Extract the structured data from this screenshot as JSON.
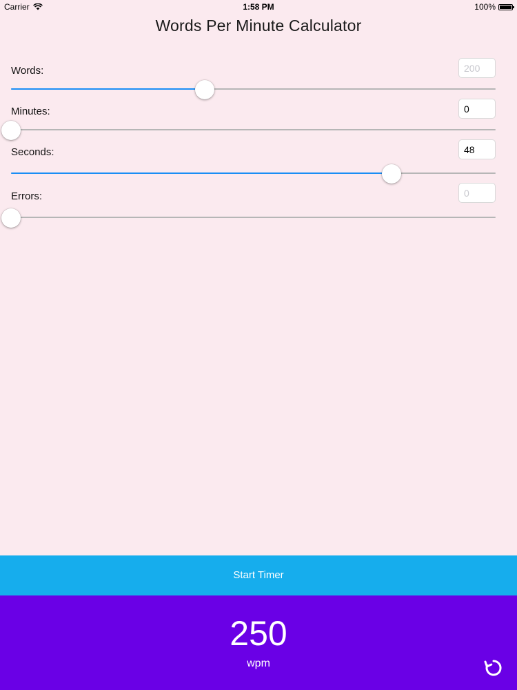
{
  "status_bar": {
    "carrier": "Carrier",
    "time": "1:58 PM",
    "battery": "100%",
    "icons": [
      "wifi-icon",
      "battery-icon"
    ]
  },
  "title": "Words Per Minute Calculator",
  "fields": [
    {
      "label": "Words:",
      "value": "",
      "placeholder": "200",
      "slider_fraction": 0.4
    },
    {
      "label": "Minutes:",
      "value": "0",
      "placeholder": "",
      "slider_fraction": 0.0
    },
    {
      "label": "Seconds:",
      "value": "48",
      "placeholder": "",
      "slider_fraction": 0.785
    },
    {
      "label": "Errors:",
      "value": "",
      "placeholder": "0",
      "slider_fraction": 0.0
    }
  ],
  "start_button": {
    "label": "Start Timer"
  },
  "result": {
    "value": "250",
    "unit": "wpm"
  },
  "reset_icon": "reset-icon",
  "colors": {
    "background": "#fbeaef",
    "slider_fill": "#1a8ef5",
    "start_button": "#16aded",
    "result_panel": "#6a00e6"
  }
}
